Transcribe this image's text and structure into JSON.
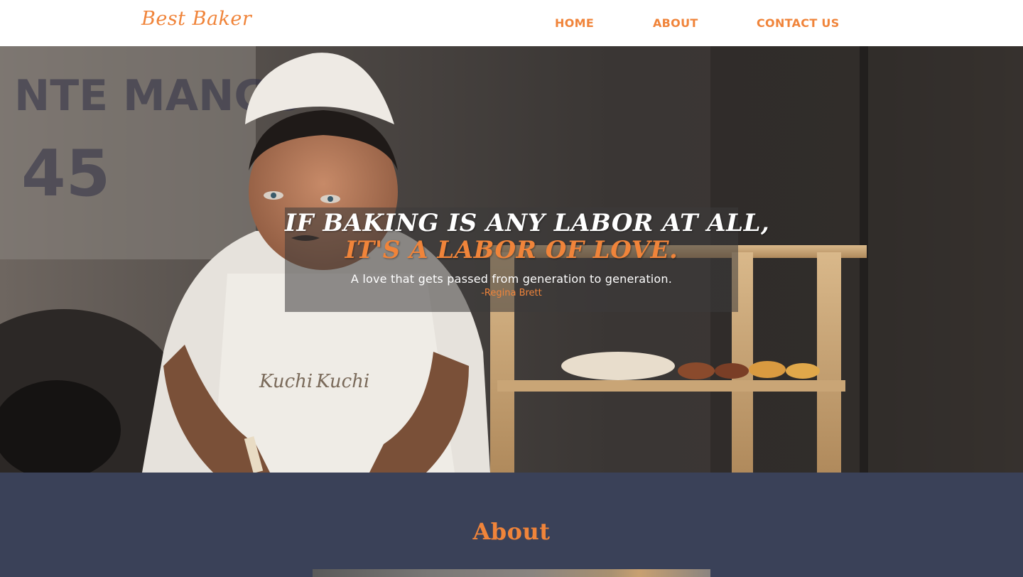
{
  "colors": {
    "accent": "#f0843a",
    "nav_bg": "#ffffff",
    "about_bg": "#3a4158",
    "hero_text": "#ffffff"
  },
  "navbar": {
    "brand": "Best Baker",
    "links": [
      "HOME",
      "ABOUT",
      "CONTACT US"
    ]
  },
  "hero": {
    "line1": "IF BAKING IS ANY LABOR AT ALL,",
    "line2": "IT'S A LABOR OF LOVE.",
    "subtitle": "A love that gets passed from generation to generation.",
    "author": "-Regina Brett"
  },
  "about": {
    "title": "About"
  }
}
